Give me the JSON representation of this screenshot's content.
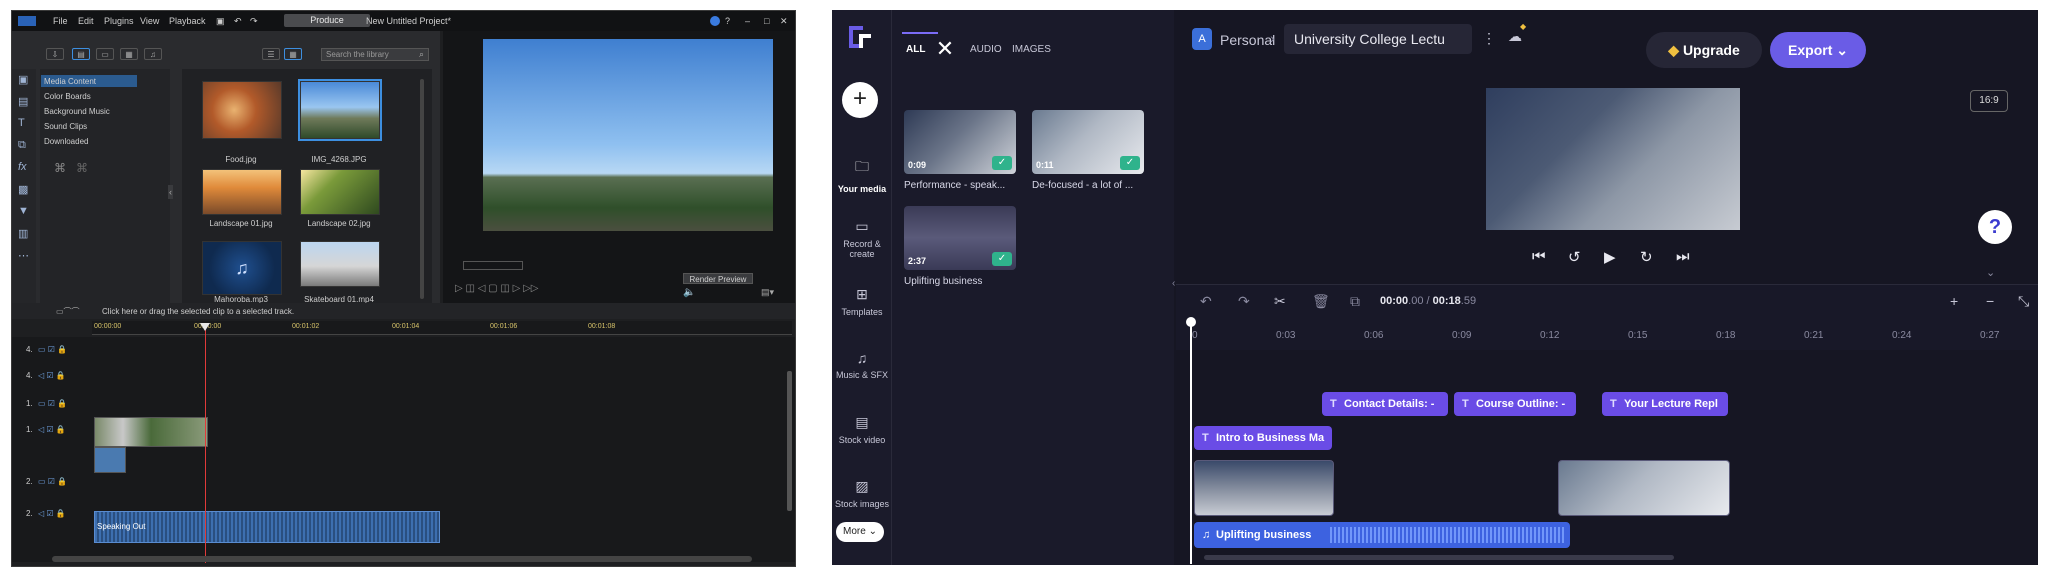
{
  "left_app": {
    "menu": [
      "File",
      "Edit",
      "Plugins",
      "View",
      "Playback"
    ],
    "produce_label": "Produce",
    "project_title": "New Untitled Project*",
    "search_placeholder": "Search the library",
    "categories": [
      "Media Content",
      "Color Boards",
      "Background Music",
      "Sound Clips",
      "Downloaded"
    ],
    "media": [
      {
        "label": "Food.jpg"
      },
      {
        "label": "IMG_4268.JPG"
      },
      {
        "label": "Landscape 01.jpg"
      },
      {
        "label": "Landscape 02.jpg"
      },
      {
        "label": "Mahoroba.mp3"
      },
      {
        "label": "Skateboard 01.mp4"
      }
    ],
    "render_preview_label": "Render Preview",
    "timeline_hint": "Click here or drag the selected clip to a selected track.",
    "ruler_ticks": [
      "00:00:00",
      "00:00:00",
      "00:01:02",
      "00:01:04",
      "00:01:06",
      "00:01:08"
    ],
    "track_labels": [
      "4.",
      "4.",
      "1.",
      "1.",
      "2.",
      "2."
    ],
    "audio_clip_label": "Speaking Out"
  },
  "right_app": {
    "nav": [
      {
        "label": "Your media",
        "icon": "folder-icon"
      },
      {
        "label": "Record & create",
        "icon": "camera-icon"
      },
      {
        "label": "Templates",
        "icon": "templates-icon"
      },
      {
        "label": "Music & SFX",
        "icon": "music-icon"
      },
      {
        "label": "Stock video",
        "icon": "film-icon"
      },
      {
        "label": "Stock images",
        "icon": "image-icon"
      }
    ],
    "more_label": "More",
    "tabs": [
      "ALL",
      "AUDIO",
      "IMAGES"
    ],
    "media": [
      {
        "duration": "0:09",
        "label": "Performance - speak..."
      },
      {
        "duration": "0:11",
        "label": "De-focused - a lot of ..."
      },
      {
        "duration": "2:37",
        "label": "Uplifting business"
      }
    ],
    "workspace_initial": "A",
    "workspace_name": "Personal",
    "project_title": "University College Lectu",
    "upgrade_label": "Upgrade",
    "export_label": "Export",
    "aspect_ratio": "16:9",
    "time_current": "00:00",
    "time_current_frac": ".00",
    "time_separator": "/",
    "time_total": "00:18",
    "time_total_frac": ".59",
    "ruler_ticks": [
      "0",
      "0:03",
      "0:06",
      "0:09",
      "0:12",
      "0:15",
      "0:18",
      "0:21",
      "0:24",
      "0:27"
    ],
    "text_clips": [
      "Contact Details: -",
      "Course Outline: -",
      "Your Lecture Repl"
    ],
    "intro_clip": "Intro to Business Ma",
    "audio_clip": "Uplifting business",
    "accent_color": "#6a5ce6"
  }
}
